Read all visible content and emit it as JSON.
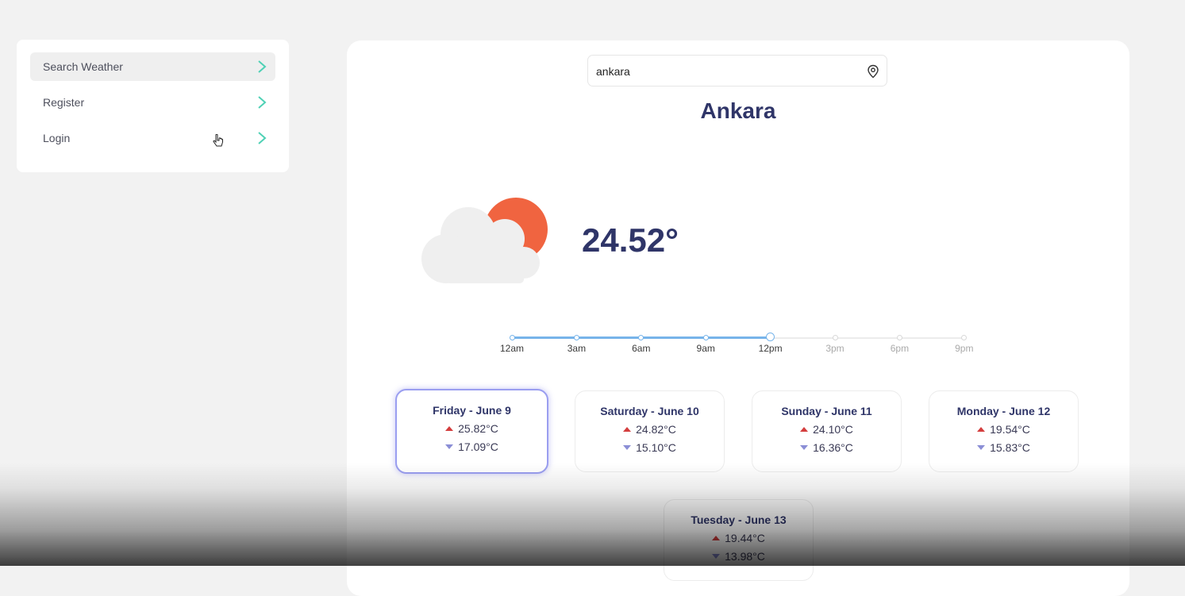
{
  "sidebar": {
    "items": [
      {
        "label": "Search Weather",
        "active": true
      },
      {
        "label": "Register",
        "active": false
      },
      {
        "label": "Login",
        "active": false
      }
    ]
  },
  "search": {
    "value": "ankara"
  },
  "city": "Ankara",
  "current": {
    "temperature": "24.52°",
    "condition_icon": "partly-cloudy-icon"
  },
  "timeline": {
    "labels": [
      "12am",
      "3am",
      "6am",
      "9am",
      "12pm",
      "3pm",
      "6pm",
      "9pm"
    ],
    "current_index": 4
  },
  "days": [
    {
      "name": "Friday - June 9",
      "high": "25.82°C",
      "low": "17.09°C",
      "selected": true
    },
    {
      "name": "Saturday - June 10",
      "high": "24.82°C",
      "low": "15.10°C",
      "selected": false
    },
    {
      "name": "Sunday - June 11",
      "high": "24.10°C",
      "low": "16.36°C",
      "selected": false
    },
    {
      "name": "Monday - June 12",
      "high": "19.54°C",
      "low": "15.83°C",
      "selected": false
    },
    {
      "name": "Tuesday - June 13",
      "high": "19.44°C",
      "low": "13.98°C",
      "selected": false
    }
  ],
  "colors": {
    "accent": "#77b4ea",
    "chevron": "#4fd1b5",
    "sun": "#f06440",
    "title": "#2f3568"
  }
}
